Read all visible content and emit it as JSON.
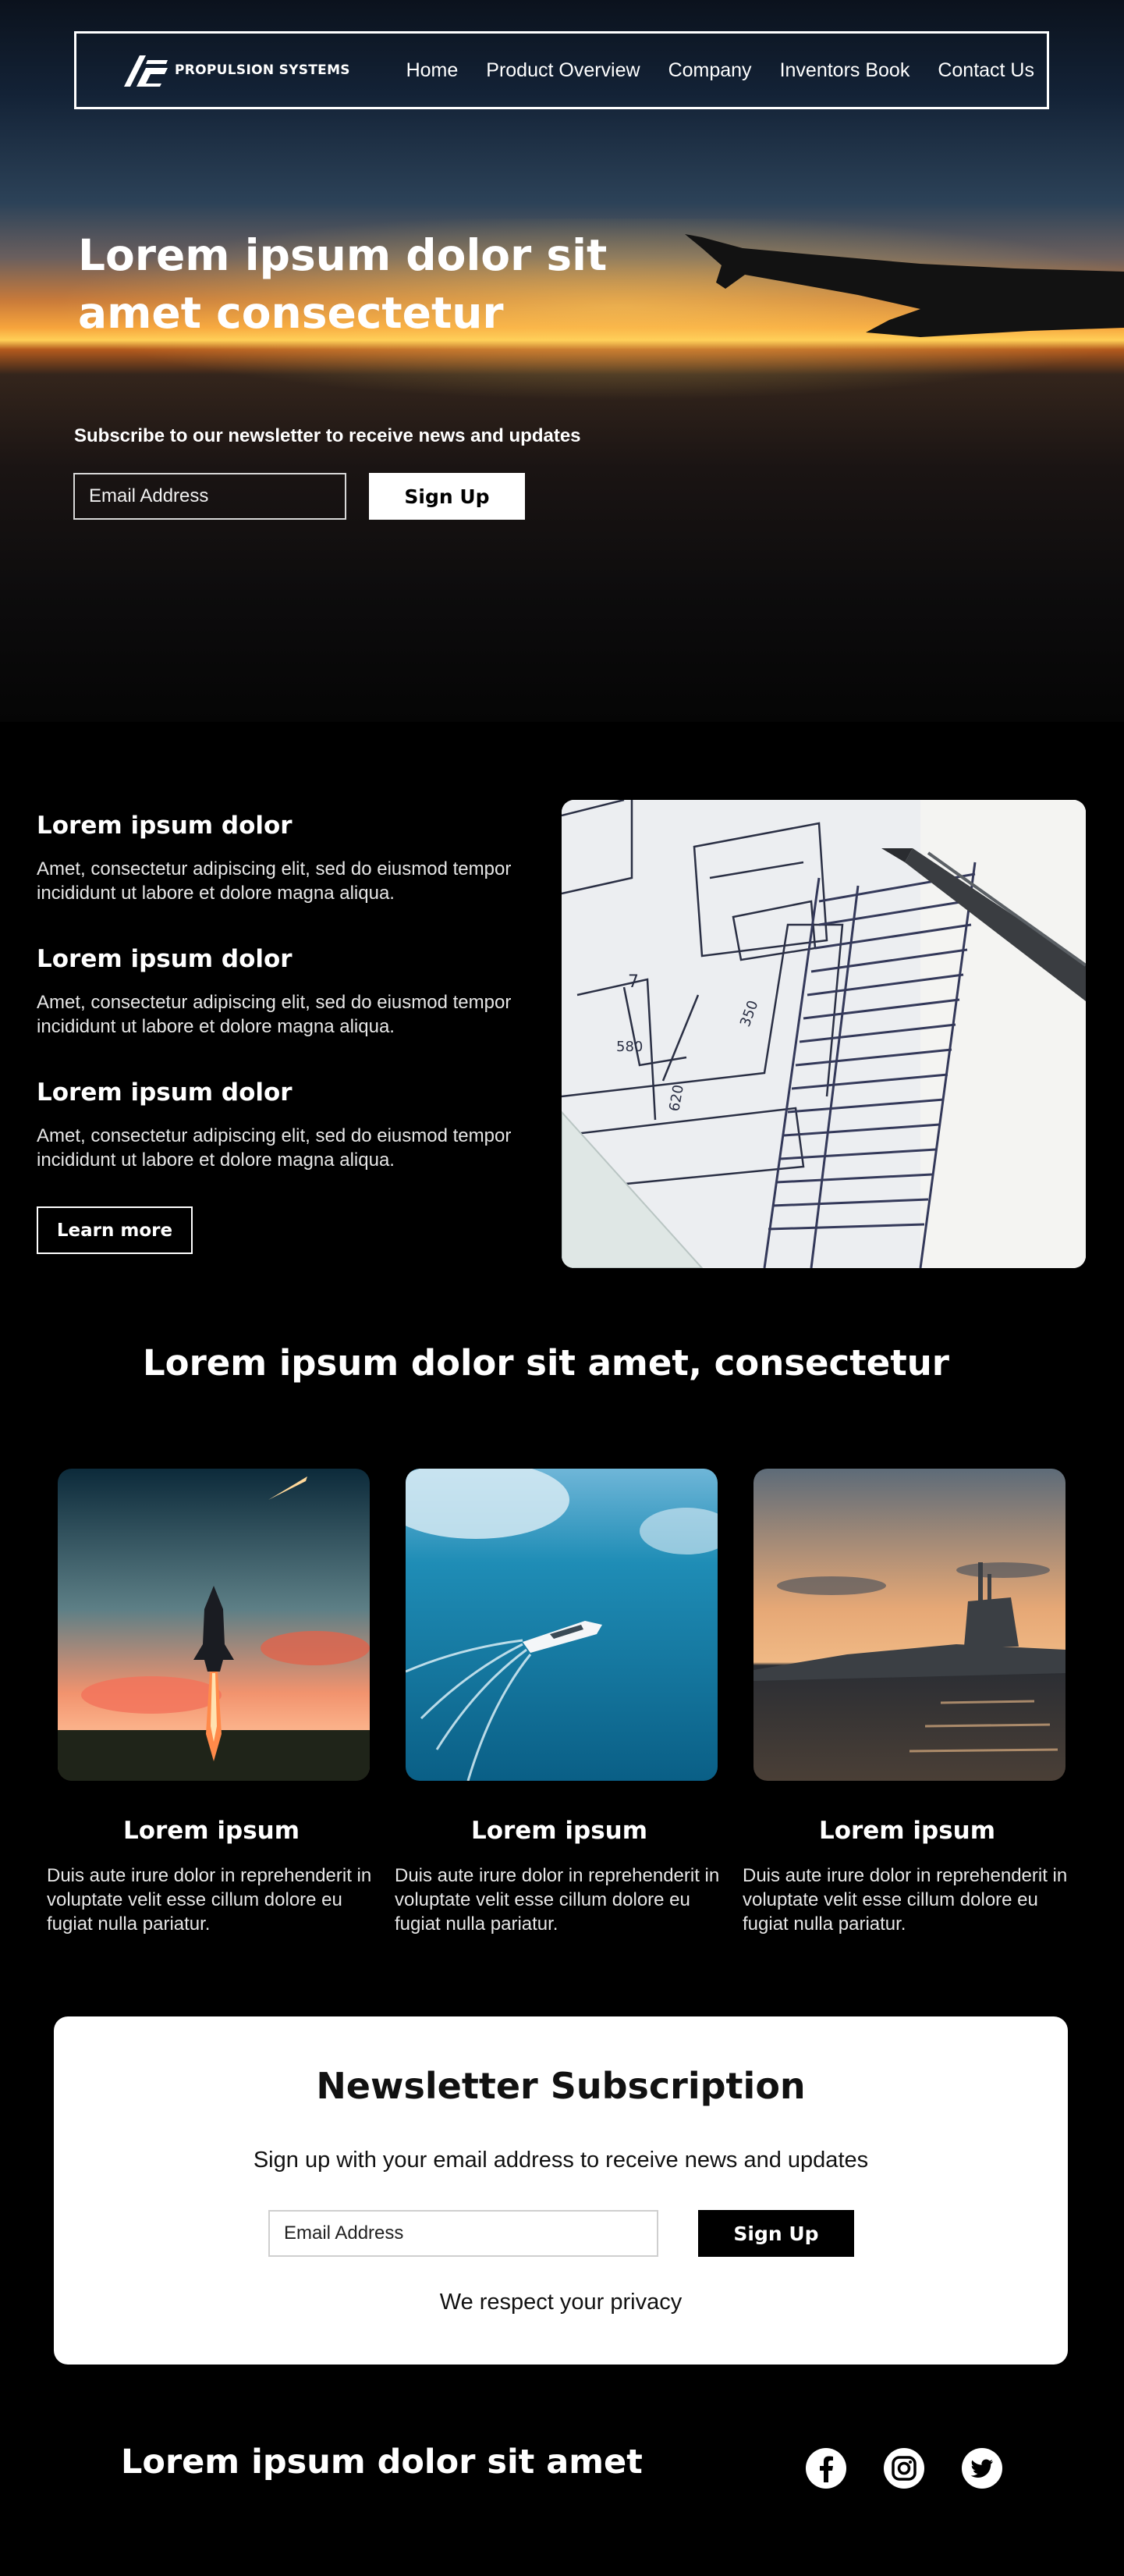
{
  "nav": {
    "brand_name": "PROPULSION SYSTEMS",
    "links": [
      "Home",
      "Product Overview",
      "Company",
      "Inventors Book",
      "Contact Us"
    ]
  },
  "hero": {
    "title": "Lorem ipsum dolor sit amet consectetur",
    "subscribe_text": "Subscribe to our newsletter  to receive news and updates",
    "email_placeholder": "Email Address",
    "signup_label": "Sign Up"
  },
  "features": {
    "items": [
      {
        "title": "Lorem ipsum dolor",
        "text": "Amet, consectetur adipiscing elit, sed do eiusmod tempor incididunt ut labore et dolore magna aliqua."
      },
      {
        "title": "Lorem ipsum dolor",
        "text": "Amet, consectetur adipiscing elit, sed do eiusmod tempor incididunt ut labore et dolore magna aliqua."
      },
      {
        "title": "Lorem ipsum dolor",
        "text": "Amet, consectetur adipiscing elit, sed do eiusmod tempor incididunt ut labore et dolore magna aliqua."
      }
    ],
    "learn_more_label": "Learn more",
    "blueprint_numbers": [
      "7",
      "580",
      "350",
      "620"
    ]
  },
  "cards": {
    "section_title": "Lorem ipsum dolor sit amet, consectetur",
    "items": [
      {
        "title": "Lorem ipsum",
        "text": "Duis aute irure dolor in reprehenderit in voluptate velit esse cillum dolore eu fugiat nulla pariatur."
      },
      {
        "title": "Lorem ipsum",
        "text": "Duis aute irure dolor in reprehenderit in voluptate velit esse cillum dolore eu fugiat nulla pariatur."
      },
      {
        "title": "Lorem ipsum",
        "text": "Duis aute irure dolor in reprehenderit in voluptate velit esse cillum dolore eu fugiat nulla pariatur."
      }
    ]
  },
  "newsletter": {
    "title": "Newsletter Subscription",
    "subtitle": "Sign up with your email address to receive news and updates",
    "email_placeholder": "Email Address",
    "signup_label": "Sign Up",
    "privacy_text": "We respect your privacy"
  },
  "footer": {
    "title": "Lorem ipsum dolor sit amet",
    "social_icons": [
      "facebook-icon",
      "instagram-icon",
      "twitter-icon"
    ]
  },
  "colors": {
    "background": "#000000",
    "sunset_orange": "#f7a43c",
    "card_panel": "#ffffff"
  }
}
